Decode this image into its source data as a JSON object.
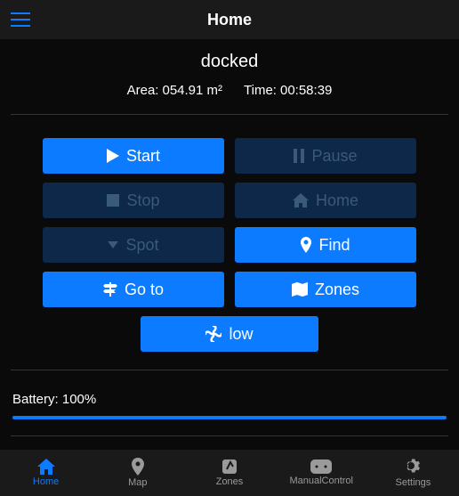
{
  "topbar": {
    "title": "Home"
  },
  "status": {
    "state": "docked",
    "area_label": "Area:",
    "area_value": "054.91 m²",
    "time_label": "Time:",
    "time_value": "00:58:39"
  },
  "buttons": {
    "start": "Start",
    "pause": "Pause",
    "stop": "Stop",
    "home": "Home",
    "spot": "Spot",
    "find": "Find",
    "goto": "Go to",
    "zones": "Zones",
    "low": "low"
  },
  "battery": {
    "label": "Battery: 100%",
    "percent": 100
  },
  "nav": {
    "home": "Home",
    "map": "Map",
    "zones": "Zones",
    "manual": "ManualControl",
    "settings": "Settings"
  }
}
